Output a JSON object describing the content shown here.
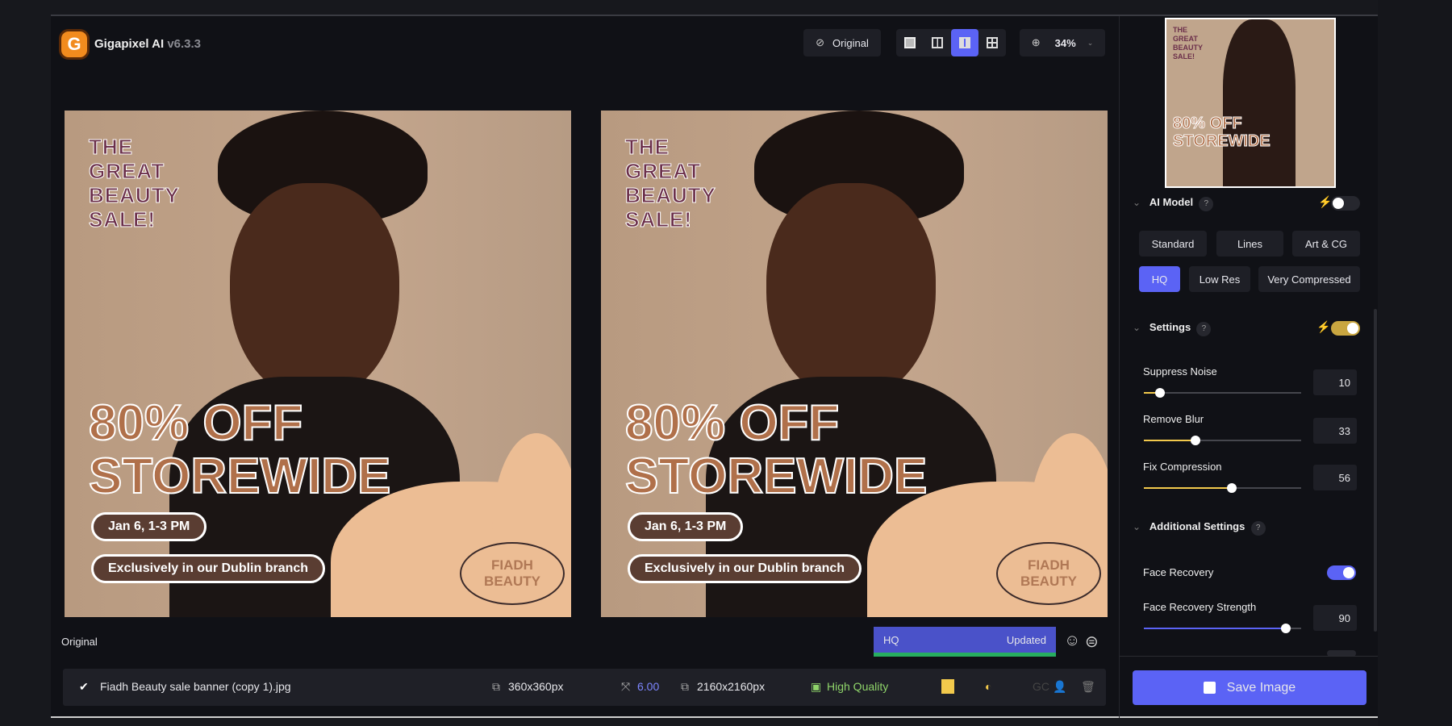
{
  "app": {
    "name": "Gigapixel AI",
    "version": "v6.3.3",
    "logo_letter": "G"
  },
  "toolbar": {
    "original_label": "Original",
    "zoom": "34%",
    "views": [
      "single-view",
      "split-view",
      "side-by-side-view",
      "grid-view"
    ],
    "active_view": "side-by-side-view"
  },
  "image": {
    "headline": [
      "THE",
      "GREAT",
      "BEAUTY",
      "SALE!"
    ],
    "offer": [
      "80% OFF",
      "STOREWIDE"
    ],
    "date": "Jan 6, 1-3 PM",
    "location": "Exclusively in our Dublin branch",
    "brand": [
      "FIADH",
      "BEAUTY"
    ]
  },
  "preview": {
    "left_label": "Original",
    "model_label": "HQ",
    "status": "Updated"
  },
  "file": {
    "name": "Fiadh Beauty sale banner (copy 1).jpg",
    "input_size": "360x360px",
    "scale": "6.00",
    "output_size": "2160x2160px",
    "quality": "High Quality",
    "gc": "GC"
  },
  "panel": {
    "ai_model": {
      "title": "AI Model",
      "help": "?",
      "auto": false,
      "models": [
        "Standard",
        "Lines",
        "Art & CG",
        "HQ",
        "Low Res",
        "Very Compressed"
      ],
      "selected": "HQ"
    },
    "settings": {
      "title": "Settings",
      "help": "?",
      "auto": true,
      "sliders": [
        {
          "label": "Suppress Noise",
          "value": 10
        },
        {
          "label": "Remove Blur",
          "value": 33
        },
        {
          "label": "Fix Compression",
          "value": 56
        }
      ]
    },
    "additional": {
      "title": "Additional Settings",
      "help": "?",
      "face_recovery_label": "Face Recovery",
      "face_recovery": true,
      "strength_label": "Face Recovery Strength",
      "strength": 90
    },
    "save_label": "Save Image"
  },
  "colors": {
    "accent": "#5b63f5",
    "yellow": "#f2c94c",
    "green": "#27ae60",
    "quality_green": "#8fd46a"
  }
}
